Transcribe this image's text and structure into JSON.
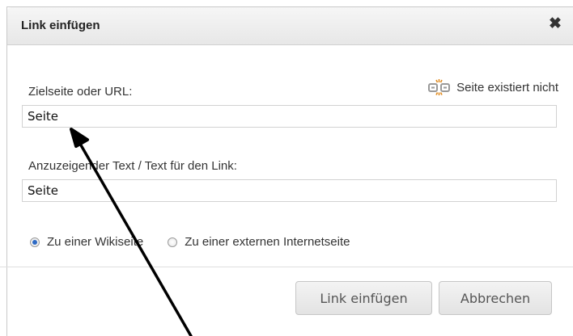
{
  "dialog": {
    "title": "Link einfügen",
    "close_symbol": "✖"
  },
  "target": {
    "label": "Zielseite oder URL:",
    "value": "Seite",
    "status_text": "Seite existiert nicht",
    "status_icon": "broken-link-icon"
  },
  "display_text": {
    "label": "Anzuzeigender Text / Text für den Link:",
    "value": "Seite"
  },
  "link_type": {
    "options": [
      {
        "label": "Zu einer Wikiseite",
        "checked": true
      },
      {
        "label": "Zu einer externen Internetseite",
        "checked": false
      }
    ]
  },
  "buttons": {
    "insert_label": "Link einfügen",
    "cancel_label": "Abbrechen"
  },
  "annotation": {
    "arrow_color": "#000000"
  }
}
